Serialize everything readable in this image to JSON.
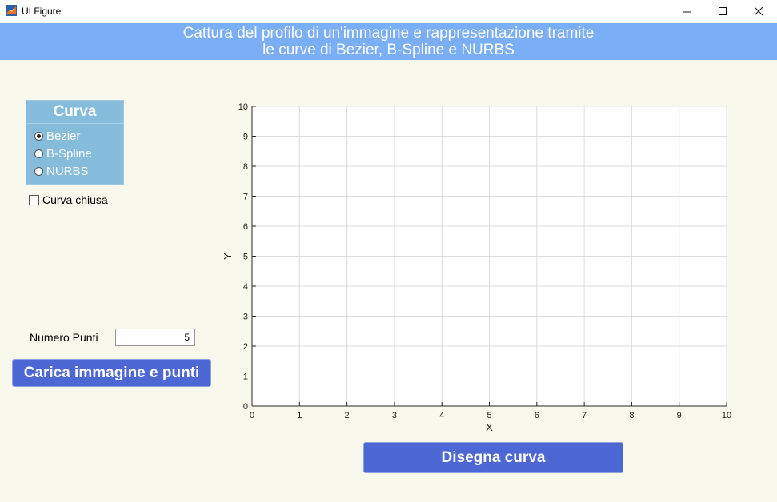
{
  "window": {
    "title": "UI Figure",
    "minimize_glyph": "—",
    "maximize_glyph": "☐",
    "close_glyph": "✕"
  },
  "header": {
    "line1": "Cattura del profilo di un'immagine e rappresentazione tramite",
    "line2": "le curve di Bezier, B-Spline e NURBS",
    "background": "#7aaef7"
  },
  "curve_panel": {
    "title": "Curva",
    "options": [
      {
        "label": "Bezier",
        "selected": true
      },
      {
        "label": "B-Spline",
        "selected": false
      },
      {
        "label": "NURBS",
        "selected": false
      }
    ],
    "background": "#86bcdb"
  },
  "closed_curve": {
    "label": "Curva chiusa",
    "checked": false
  },
  "points": {
    "label": "Numero Punti",
    "value": "5"
  },
  "buttons": {
    "load": "Carica immagine e punti",
    "draw": "Disegna curva",
    "color": "#4d67d4"
  },
  "chart_data": {
    "type": "line",
    "title": "",
    "xlabel": "X",
    "ylabel": "Y",
    "xlim": [
      0,
      10
    ],
    "ylim": [
      0,
      10
    ],
    "xticks": [
      "0",
      "1",
      "2",
      "3",
      "4",
      "5",
      "6",
      "7",
      "8",
      "9",
      "10"
    ],
    "yticks": [
      "0",
      "1",
      "2",
      "3",
      "4",
      "5",
      "6",
      "7",
      "8",
      "9",
      "10"
    ],
    "grid": true,
    "series": []
  }
}
